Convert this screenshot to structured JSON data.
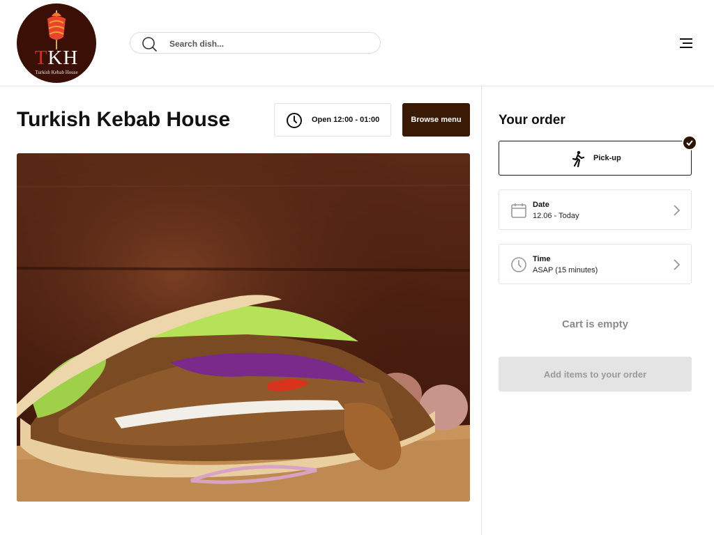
{
  "header": {
    "logo": {
      "initial_red": "T",
      "initials_rest": "KH",
      "subtitle": "Turkish Kebab House"
    },
    "search": {
      "placeholder": "Search dish...",
      "icon": "search-icon"
    },
    "menu_icon": "hamburger-menu-icon"
  },
  "main": {
    "title": "Turkish Kebab House",
    "hours": {
      "icon": "clock-icon",
      "text": "Open 12:00 - 01:00"
    },
    "browse_label": "Browse menu",
    "hero_image": "kebab-photo"
  },
  "order": {
    "title": "Your order",
    "pickup": {
      "icon": "walking-person-icon",
      "label": "Pick-up",
      "selected": true
    },
    "date": {
      "icon": "calendar-icon",
      "label": "Date",
      "value": "12.06 - Today"
    },
    "time": {
      "icon": "clock-icon",
      "label": "Time",
      "value": "ASAP (15 minutes)"
    },
    "empty_text": "Cart is empty",
    "add_button": "Add items to your order"
  },
  "colors": {
    "brand_dark": "#3a1a05",
    "logo_bg": "#3a0f06",
    "logo_red": "#e02a1c",
    "disabled_bg": "#e4e4e4",
    "muted_text": "#8a8a8a"
  }
}
